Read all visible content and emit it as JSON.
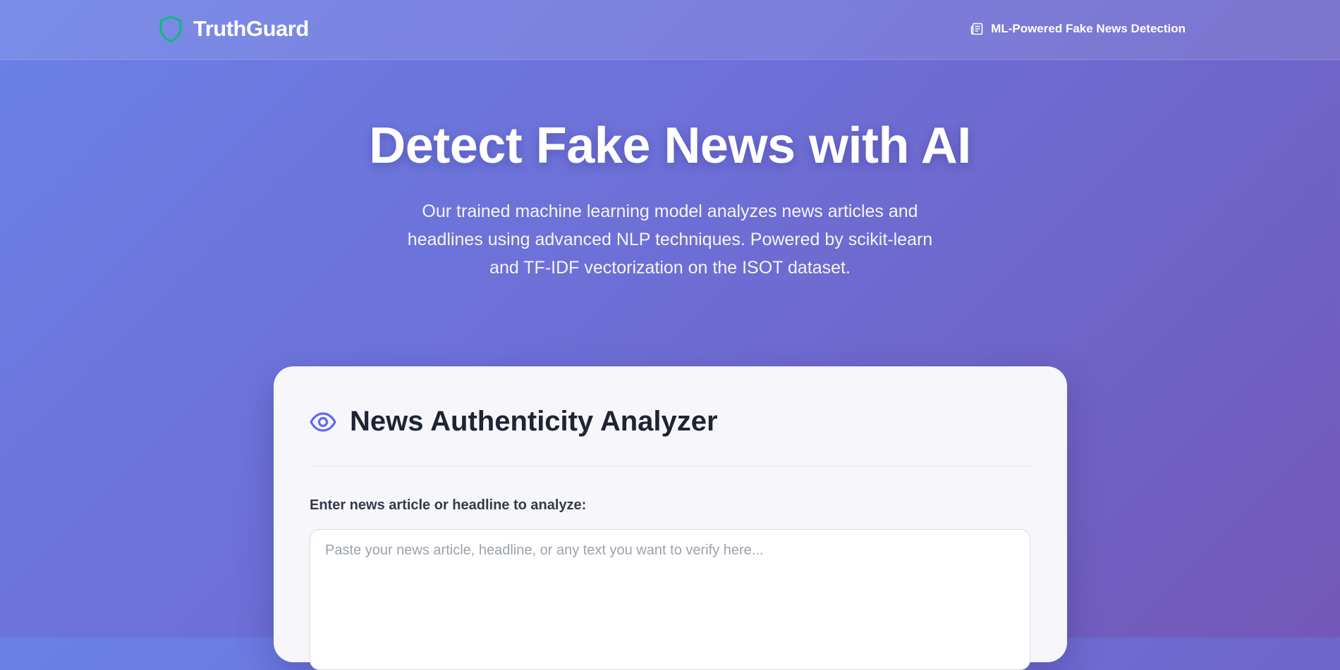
{
  "header": {
    "brand_name": "TruthGuard",
    "brand_icon": "shield-icon",
    "tagline": "ML-Powered Fake News Detection",
    "tagline_icon": "newspaper-icon"
  },
  "hero": {
    "title": "Detect Fake News with AI",
    "subtitle": "Our trained machine learning model analyzes news articles and headlines using advanced NLP techniques. Powered by scikit-learn and TF-IDF vectorization on the ISOT dataset."
  },
  "analyzer": {
    "icon": "eye-icon",
    "title": "News Authenticity Analyzer",
    "input_label": "Enter news article or headline to analyze:",
    "input_placeholder": "Paste your news article, headline, or any text you want to verify here...",
    "input_value": ""
  },
  "colors": {
    "accent": "#6366f1",
    "brand_icon": "#10b981",
    "background_start": "#6b80e6",
    "background_end": "#7258b8"
  }
}
